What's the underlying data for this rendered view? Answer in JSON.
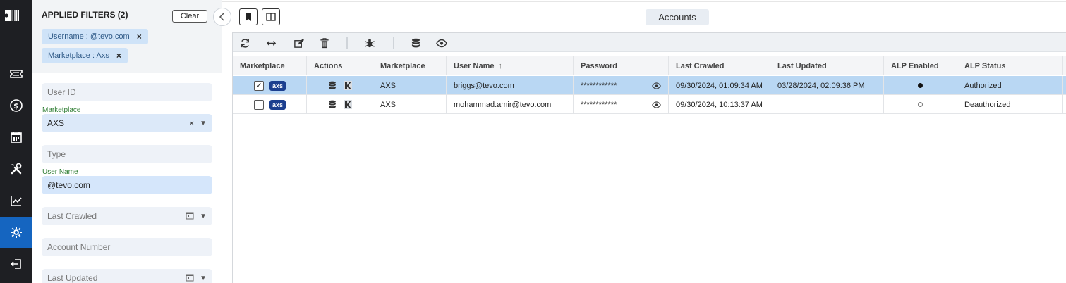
{
  "title_tab": "Accounts",
  "filters": {
    "applied_title": "APPLIED FILTERS (2)",
    "clear_label": "Clear",
    "chips": [
      {
        "label": "Username : @tevo.com"
      },
      {
        "label": "Marketplace : Axs"
      }
    ],
    "user_id": {
      "placeholder": "User ID"
    },
    "marketplace": {
      "label": "Marketplace",
      "value": "AXS"
    },
    "type": {
      "placeholder": "Type"
    },
    "user_name": {
      "label": "User Name",
      "value": "@tevo.com"
    },
    "last_crawled": {
      "placeholder": "Last Crawled"
    },
    "account_number": {
      "placeholder": "Account Number"
    },
    "last_updated": {
      "placeholder": "Last Updated"
    }
  },
  "rail_icons": [
    "ticket-icon",
    "dollar-icon",
    "calendar-icon",
    "tools-icon",
    "chart-icon",
    "settings-icon",
    "logout-icon"
  ],
  "toolbar_icons": [
    "refresh-icon",
    "resize-icon",
    "edit-icon",
    "delete-icon",
    "bug-icon",
    "database-icon",
    "eye-icon"
  ],
  "table": {
    "columns": [
      "Marketplace",
      "Actions",
      "Marketplace",
      "User Name",
      "Password",
      "Last Crawled",
      "Last Updated",
      "ALP Enabled",
      "ALP Status"
    ],
    "sort_indicator": "↑",
    "rows": [
      {
        "checked": "✓",
        "badge": "axs",
        "marketplace": "AXS",
        "user_name": "briggs@tevo.com",
        "password": "************",
        "last_crawled": "09/30/2024, 01:09:34 AM",
        "last_updated": "03/28/2024, 02:09:36 PM",
        "alp_enabled": true,
        "alp_status": "Authorized",
        "selected": true
      },
      {
        "checked": "",
        "badge": "axs",
        "marketplace": "AXS",
        "user_name": "mohammad.amir@tevo.com",
        "password": "************",
        "last_crawled": "09/30/2024, 10:13:37 AM",
        "last_updated": "",
        "alp_enabled": false,
        "alp_status": "Deauthorized",
        "selected": false
      }
    ]
  },
  "colors": {
    "rail": "#1e1f23",
    "active": "#1565c0",
    "selected_row": "#b9d7f3",
    "chip": "#cfe3f8",
    "axs_badge": "#1b3f8f"
  }
}
